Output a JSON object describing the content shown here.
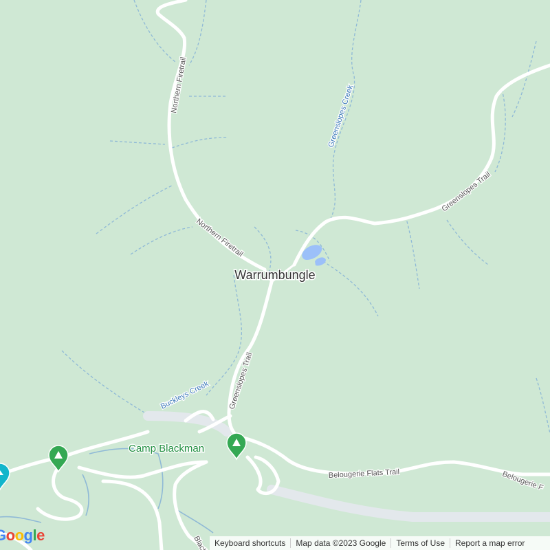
{
  "map": {
    "place_label": "Warrumbungle",
    "poi": {
      "camp_label": "Camp Blackman"
    },
    "roads": {
      "northern_firetrail": "Northern Firetrail",
      "greenslopes_trail": "Greenslopes Trail",
      "belougerie_flats_trail": "Belougerie Flats Trail",
      "belougerie_partial": "Belougerie F",
      "black_partial": "Black"
    },
    "waterways": {
      "greenslopes_creek": "Greenslopes Creek",
      "buckleys_creek": "Buckleys Creek"
    }
  },
  "attribution": {
    "keyboard": "Keyboard shortcuts",
    "map_data": "Map data ©2023 Google",
    "terms": "Terms of Use",
    "report": "Report a map error"
  },
  "logo_text": "Google",
  "colors": {
    "land": "#cfe8d4",
    "road": "#ffffff",
    "major_road": "#e3e8ec",
    "creek_line": "#8fb9d6",
    "water": "#9cc0f9",
    "label_water": "#3a78b8",
    "label_road": "#555555",
    "poi_green": "#34a853"
  }
}
